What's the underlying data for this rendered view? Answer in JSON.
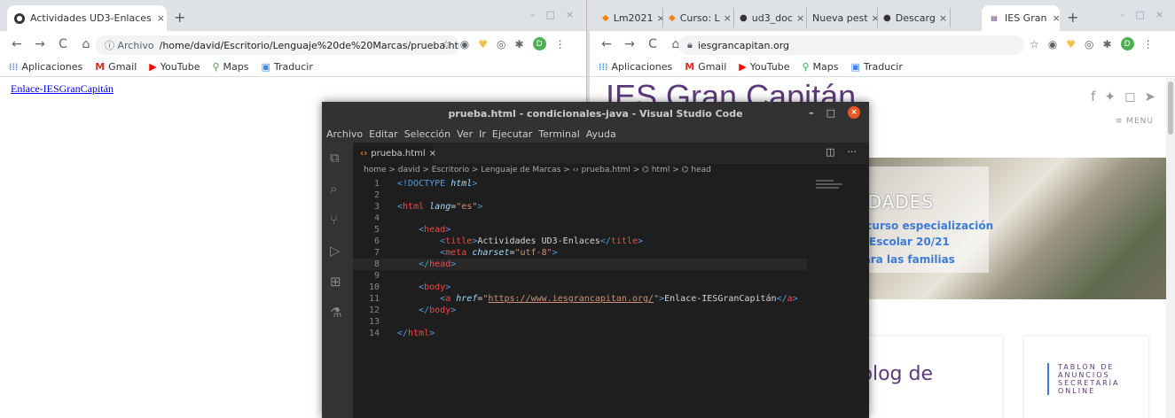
{
  "left_browser": {
    "tab_title": "Actividades UD3-Enlaces",
    "tab_close": "×",
    "new_tab": "+",
    "url_scheme": "ⓘ Archivo",
    "url": "/home/david/Escritorio/Lenguaje%20de%20Marcas/prueba.html",
    "profile_initial": "D",
    "page_link": "Enlace-IESGranCapitán"
  },
  "bookmarks": {
    "apps": "Aplicaciones",
    "gmail": "Gmail",
    "youtube": "YouTube",
    "maps": "Maps",
    "translate": "Traducir"
  },
  "right_browser": {
    "tabs": [
      {
        "title": "Lm2021",
        "close": "×"
      },
      {
        "title": "Curso: L",
        "close": "×"
      },
      {
        "title": "ud3_doc",
        "close": "×"
      },
      {
        "title": "Nueva pest",
        "close": "×"
      },
      {
        "title": "Descarg",
        "close": "×"
      },
      {
        "title": "IES Gran",
        "close": "×"
      }
    ],
    "new_tab": "+",
    "url": "iesgrancapitan.org",
    "profile_initial": "D",
    "site_title": "IES Gran Capitán",
    "menu_label": "≡ MENU",
    "hero_heading": "EDADES",
    "hero_links": [
      "s curso especialización",
      "Escolar 20/21",
      "para las familias"
    ],
    "hero_t": "T",
    "blog_text": "blog de",
    "tablon_lines": [
      "TABLÓN DE",
      "ANUNCIOS",
      "SECRETARÍA",
      "ONLINE"
    ]
  },
  "vscode": {
    "title": "prueba.html - condicionales-java - Visual Studio Code",
    "menu": [
      "Archivo",
      "Editar",
      "Selección",
      "Ver",
      "Ir",
      "Ejecutar",
      "Terminal",
      "Ayuda"
    ],
    "tab_label": "prueba.html",
    "tab_close": "×",
    "breadcrumb": "home > david > Escritorio > Lenguaje de Marcas > ‹› prueba.html > ⌬ html > ⌬ head",
    "lines": [
      {
        "n": "1",
        "html": "<span class='tag'>&lt;!DOCTYPE</span> <span class='at'>html</span><span class='tag'>&gt;</span>"
      },
      {
        "n": "2",
        "html": ""
      },
      {
        "n": "3",
        "html": "<span class='tag'>&lt;</span><span class='tn'>html</span> <span class='at'>lang</span><span class='txt'>=</span><span class='st'>\"es\"</span><span class='tag'>&gt;</span>"
      },
      {
        "n": "4",
        "html": ""
      },
      {
        "n": "5",
        "html": "    <span class='tag'>&lt;</span><span class='tn'>head</span><span class='tag'>&gt;</span>"
      },
      {
        "n": "6",
        "html": "        <span class='tag'>&lt;</span><span class='tn'>title</span><span class='tag'>&gt;</span><span class='txt'>Actividades UD3-Enlaces</span><span class='tag'>&lt;/</span><span class='tn'>title</span><span class='tag'>&gt;</span>"
      },
      {
        "n": "7",
        "html": "        <span class='tag'>&lt;</span><span class='tn'>meta</span> <span class='at'>charset</span><span class='txt'>=</span><span class='st'>\"utf-8\"</span><span class='tag'>&gt;</span>"
      },
      {
        "n": "8",
        "html": "    <span class='tag'>&lt;/</span><span class='tn'>head</span><span class='tag'>&gt;</span>"
      },
      {
        "n": "9",
        "html": ""
      },
      {
        "n": "10",
        "html": "    <span class='tag'>&lt;</span><span class='tn'>body</span><span class='tag'>&gt;</span>"
      },
      {
        "n": "11",
        "html": "        <span class='tag'>&lt;</span><span class='tn'>a</span> <span class='at'>href</span><span class='txt'>=</span><span class='st'>\"</span><span class='lk'>https://www.iesgrancapitan.org/</span><span class='st'>\"</span><span class='tag'>&gt;</span><span class='txt'>Enlace-IESGranCapitán</span><span class='tag'>&lt;/</span><span class='tn'>a</span><span class='tag'>&gt;</span>"
      },
      {
        "n": "12",
        "html": "    <span class='tag'>&lt;/</span><span class='tn'>body</span><span class='tag'>&gt;</span>"
      },
      {
        "n": "13",
        "html": ""
      },
      {
        "n": "14",
        "html": "<span class='tag'>&lt;/</span><span class='tn'>html</span><span class='tag'>&gt;</span>"
      }
    ],
    "current_line": "8"
  }
}
